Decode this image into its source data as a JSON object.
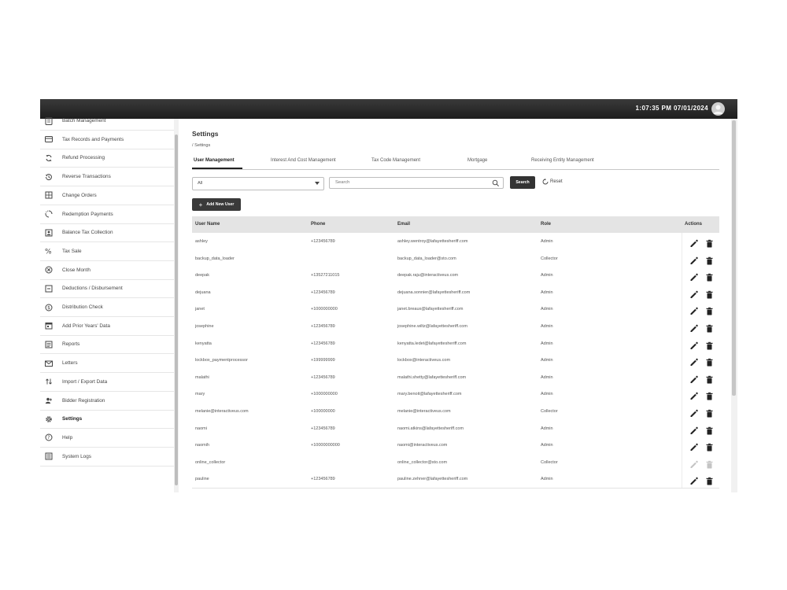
{
  "header": {
    "clock": "1:07:35 PM 07/01/2024"
  },
  "sidebar": {
    "items": [
      {
        "label": "Batch Management",
        "icon": "clipboard-icon"
      },
      {
        "label": "Tax Records and Payments",
        "icon": "credit-card-icon"
      },
      {
        "label": "Refund Processing",
        "icon": "refresh-icon"
      },
      {
        "label": "Reverse Transactions",
        "icon": "history-icon"
      },
      {
        "label": "Change Orders",
        "icon": "grid-icon"
      },
      {
        "label": "Redemption Payments",
        "icon": "cycle-icon"
      },
      {
        "label": "Balance Tax Collection",
        "icon": "balance-icon"
      },
      {
        "label": "Tax Sale",
        "icon": "percent-icon"
      },
      {
        "label": "Close Month",
        "icon": "close-circle-icon"
      },
      {
        "label": "Deductions / Disbursement",
        "icon": "minus-box-icon"
      },
      {
        "label": "Distribution Check",
        "icon": "dollar-circle-icon"
      },
      {
        "label": "Add Prior Years' Data",
        "icon": "calendar-icon"
      },
      {
        "label": "Reports",
        "icon": "report-icon"
      },
      {
        "label": "Letters",
        "icon": "mail-icon"
      },
      {
        "label": "Import / Export Data",
        "icon": "import-export-icon"
      },
      {
        "label": "Bidder Registration",
        "icon": "user-add-icon"
      },
      {
        "label": "Settings",
        "icon": "gear-icon",
        "active": true
      },
      {
        "label": "Help",
        "icon": "help-icon"
      },
      {
        "label": "System Logs",
        "icon": "log-icon"
      }
    ]
  },
  "main": {
    "title": "Settings",
    "breadcrumb": "/ Settings",
    "tabs": [
      {
        "label": "User Management",
        "active": true
      },
      {
        "label": "Interest And Cost Management"
      },
      {
        "label": "Tax Code Management"
      },
      {
        "label": "Mortgage"
      },
      {
        "label": "Receiving Entity Management"
      }
    ],
    "filter": {
      "role_selected": "All",
      "search_placeholder": "Search",
      "search_button": "Search",
      "reset_button": "Reset"
    },
    "add_button": "Add New User"
  },
  "table": {
    "columns": [
      "User Name",
      "Phone",
      "Email",
      "Role",
      "Actions"
    ],
    "rows": [
      {
        "name": "ashley",
        "phone": "+123456789",
        "email": "ashley.wentroy@lafayettesheriff.com",
        "role": "Admin",
        "disabled": false
      },
      {
        "name": "backup_data_loader",
        "phone": "",
        "email": "backup_data_loader@sto.com",
        "role": "Collector",
        "disabled": false
      },
      {
        "name": "deepak",
        "phone": "+13527211015",
        "email": "deepak.raju@interactiveus.com",
        "role": "Admin",
        "disabled": false
      },
      {
        "name": "dejuana",
        "phone": "+123456789",
        "email": "dejuana.sonnier@lafayettesheriff.com",
        "role": "Admin",
        "disabled": false
      },
      {
        "name": "janet",
        "phone": "+1000000000",
        "email": "janet.breaux@lafayettesheriff.com",
        "role": "Admin",
        "disabled": false
      },
      {
        "name": "josephine",
        "phone": "+123456789",
        "email": "josephine.wiltz@lafayettesheriff.com",
        "role": "Admin",
        "disabled": false
      },
      {
        "name": "kenyatta",
        "phone": "+123456789",
        "email": "kenyatta.ledet@lafayettesheriff.com",
        "role": "Admin",
        "disabled": false
      },
      {
        "name": "lockbox_paymentprocessor",
        "phone": "+199999999",
        "email": "lockbox@interactiveus.com",
        "role": "Admin",
        "disabled": false
      },
      {
        "name": "malathi",
        "phone": "+123456789",
        "email": "malathi.shetty@lafayettesheriff.com",
        "role": "Admin",
        "disabled": false
      },
      {
        "name": "mary",
        "phone": "+1000000000",
        "email": "mary.benoit@lafayettesheriff.com",
        "role": "Admin",
        "disabled": false
      },
      {
        "name": "melanie@interactiveus.com",
        "phone": "+100000000",
        "email": "melanie@interactiveus.com",
        "role": "Collector",
        "disabled": false
      },
      {
        "name": "naomi",
        "phone": "+123456789",
        "email": "naomi.atkins@lafayettesheriff.com",
        "role": "Admin",
        "disabled": false
      },
      {
        "name": "naomih",
        "phone": "+10000000000",
        "email": "naomi@interactiveus.com",
        "role": "Admin",
        "disabled": false
      },
      {
        "name": "online_collector",
        "phone": "",
        "email": "online_collector@sto.com",
        "role": "Collector",
        "disabled": true
      },
      {
        "name": "pauline",
        "phone": "+123456789",
        "email": "pauline.zehner@lafayettesheriff.com",
        "role": "Admin",
        "disabled": false
      }
    ]
  }
}
